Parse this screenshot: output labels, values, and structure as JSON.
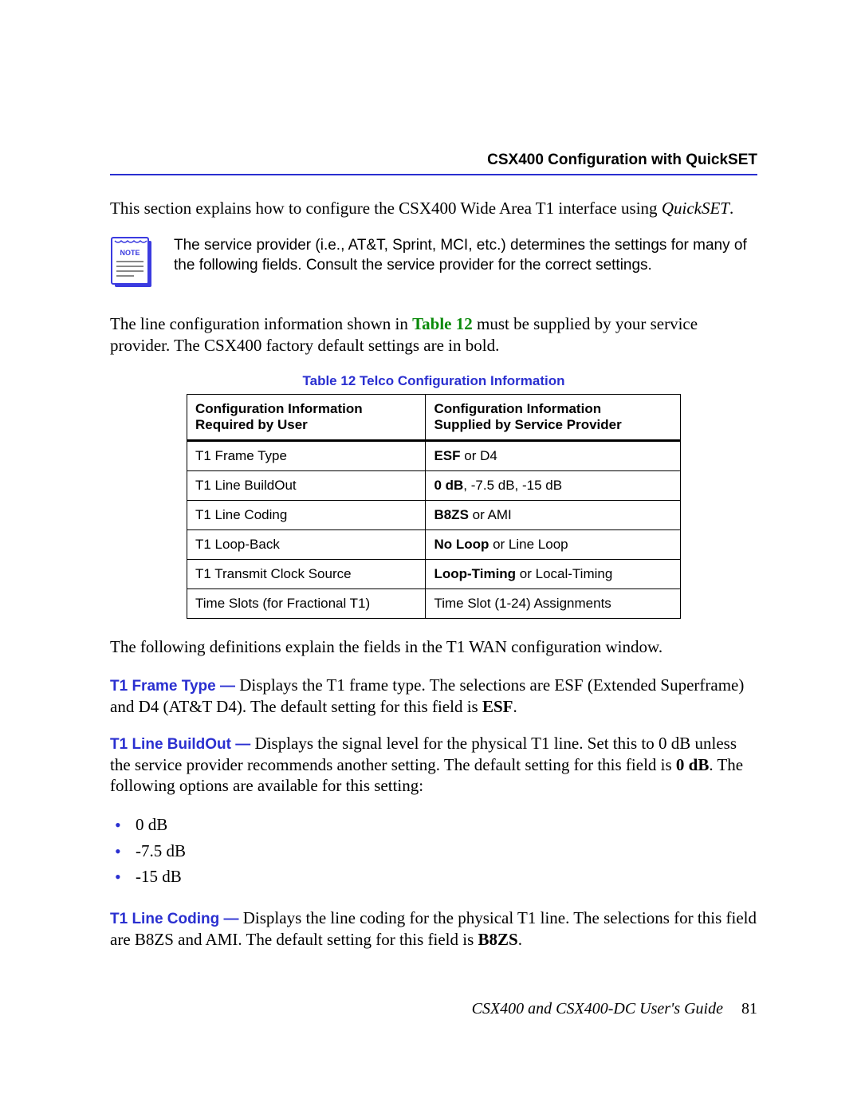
{
  "header": {
    "title": "CSX400 Configuration with QuickSET"
  },
  "intro": {
    "prefix": "This section explains how to configure the CSX400 Wide Area T1 interface using ",
    "em": "QuickSET",
    "suffix": "."
  },
  "note": {
    "label": "NOTE",
    "text": "The service provider (i.e., AT&T, Sprint, MCI, etc.) determines the settings for many of the following fields. Consult the service provider for the correct settings."
  },
  "line_config": {
    "pre": "The line configuration information shown in ",
    "ref": "Table 12",
    "post": " must be supplied by your service provider. The CSX400 factory default settings are in bold."
  },
  "table": {
    "caption": "Table 12  Telco Configuration Information",
    "head": {
      "left_l1": "Configuration Information",
      "left_l2": "Required by User",
      "right_l1": "Configuration Information",
      "right_l2": "Supplied by Service Provider"
    },
    "rows": [
      {
        "left": "T1 Frame Type",
        "right_bold": "ESF",
        "right_rest": " or D4"
      },
      {
        "left": "T1 Line BuildOut",
        "right_bold": "0 dB",
        "right_rest": ", -7.5 dB, -15 dB"
      },
      {
        "left": "T1 Line Coding",
        "right_bold": "B8ZS",
        "right_rest": " or AMI"
      },
      {
        "left": "T1 Loop-Back",
        "right_bold": "No Loop",
        "right_rest": " or Line Loop"
      },
      {
        "left": "T1 Transmit Clock Source",
        "right_bold": "Loop-Timing",
        "right_rest": " or Local-Timing"
      },
      {
        "left": "Time Slots (for Fractional T1)",
        "right_bold": "",
        "right_rest": "Time Slot (1-24) Assignments"
      }
    ]
  },
  "defs_intro": "The following definitions explain the fields in the T1 WAN configuration window.",
  "def1": {
    "term": "T1 Frame Type  —",
    "pre": "  Displays the T1 frame type. The selections are ESF (Extended Superframe) and D4 (AT&T D4). The default setting for this field is ",
    "bold": "ESF",
    "post": "."
  },
  "def2": {
    "term": "T1 Line BuildOut  —",
    "pre": "  Displays the signal level for the physical T1 line. Set this to 0 dB unless the service provider recommends another setting. The default setting for this field is ",
    "bold": "0 dB",
    "post": ". The following options are available for this setting:"
  },
  "bullets": [
    "0 dB",
    "-7.5 dB",
    "-15 dB"
  ],
  "def3": {
    "term": "T1 Line Coding  —",
    "pre": "  Displays the line coding for the physical T1 line. The selections for this field are B8ZS and AMI. The default setting for this field is ",
    "bold": "B8ZS",
    "post": "."
  },
  "footer": {
    "title": "CSX400 and CSX400-DC User's Guide",
    "page": "81"
  }
}
